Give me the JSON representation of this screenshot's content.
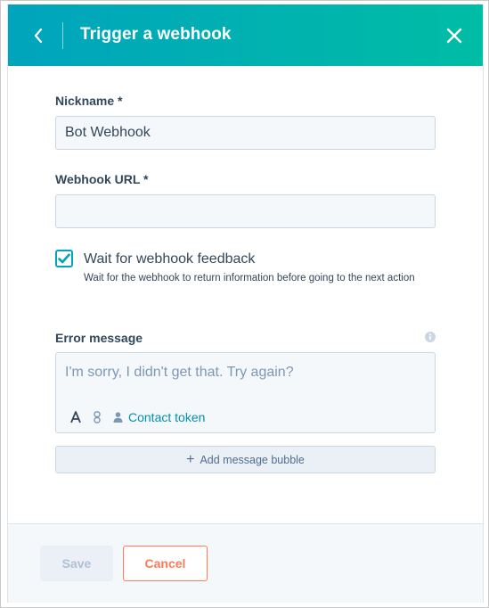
{
  "header": {
    "title": "Trigger a webhook"
  },
  "form": {
    "nickname": {
      "label": "Nickname *",
      "value": "Bot Webhook"
    },
    "webhook_url": {
      "label": "Webhook URL *",
      "value": ""
    },
    "wait_feedback": {
      "checked": true,
      "label": "Wait for webhook feedback",
      "help": "Wait for the webhook to return information before going to the next action"
    },
    "error_message": {
      "label": "Error message",
      "placeholder": "I'm sorry, I didn't get that. Try again?",
      "contact_token_label": "Contact token"
    },
    "add_bubble_label": "Add message bubble"
  },
  "footer": {
    "save_label": "Save",
    "cancel_label": "Cancel"
  },
  "colors": {
    "header_start": "#00a4bd",
    "header_end": "#00bda5",
    "checkbox": "#00a4bd",
    "link": "#0091ae",
    "cancel": "#ff7a59"
  },
  "icons": {
    "back": "chevron-left-icon",
    "close": "close-icon",
    "info": "info-icon",
    "text_format": "text-format-icon",
    "link": "link-icon",
    "contact": "person-icon",
    "add": "plus-icon"
  }
}
